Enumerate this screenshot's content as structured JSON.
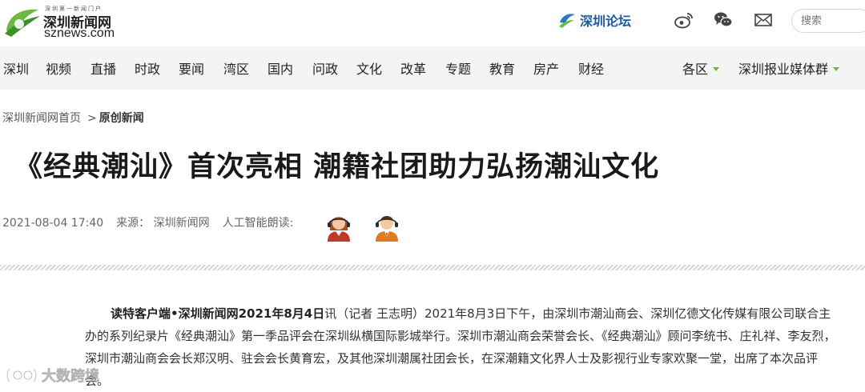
{
  "header": {
    "logo": {
      "tagline": "深圳第一新闻门户",
      "name_cn": "深圳新闻网",
      "name_en": "sznews.com"
    },
    "forum_label": "深圳论坛",
    "social_icons": [
      "weibo-icon",
      "wechat-icon",
      "mail-icon"
    ],
    "search": {
      "placeholder": "搜索"
    }
  },
  "nav": {
    "items": [
      "深圳",
      "视频",
      "直播",
      "时政",
      "要闻",
      "湾区",
      "国内",
      "问政",
      "文化",
      "改革",
      "专题",
      "教育",
      "房产",
      "财经"
    ],
    "regions_label": "各区",
    "media_group_label": "深圳报业媒体群",
    "accent_color": "#6cb840"
  },
  "breadcrumb": {
    "home": "深圳新闻网首页",
    "separator": ">",
    "current": "原创新闻"
  },
  "article": {
    "title": "《经典潮汕》首次亮相 潮籍社团助力弘扬潮汕文化",
    "datetime": "2021-08-04 17:40",
    "source": "来源：  深圳新闻网",
    "ai_reading_label": "人工智能朗读:",
    "body_lead": "读特客户端•深圳新闻网2021年8月4日",
    "body_text": "讯（记者 王志明）2021年8月3日下午，由深圳市潮汕商会、深圳亿德文化传媒有限公司联合主办的系列纪录片《经典潮汕》第一季品评会在深圳纵横国际影城举行。深圳市潮汕商会荣誉会长、《经典潮汕》顾问李统书、庄礼祥、李友烈，深圳市潮汕商会会长郑汉明、驻会会长黄育宏，及其他深圳潮属社团会长，在深潮籍文化界人士及影视行业专家欢聚一堂，出席了本次品评会。"
  },
  "watermark": {
    "text": "大数跨境"
  }
}
